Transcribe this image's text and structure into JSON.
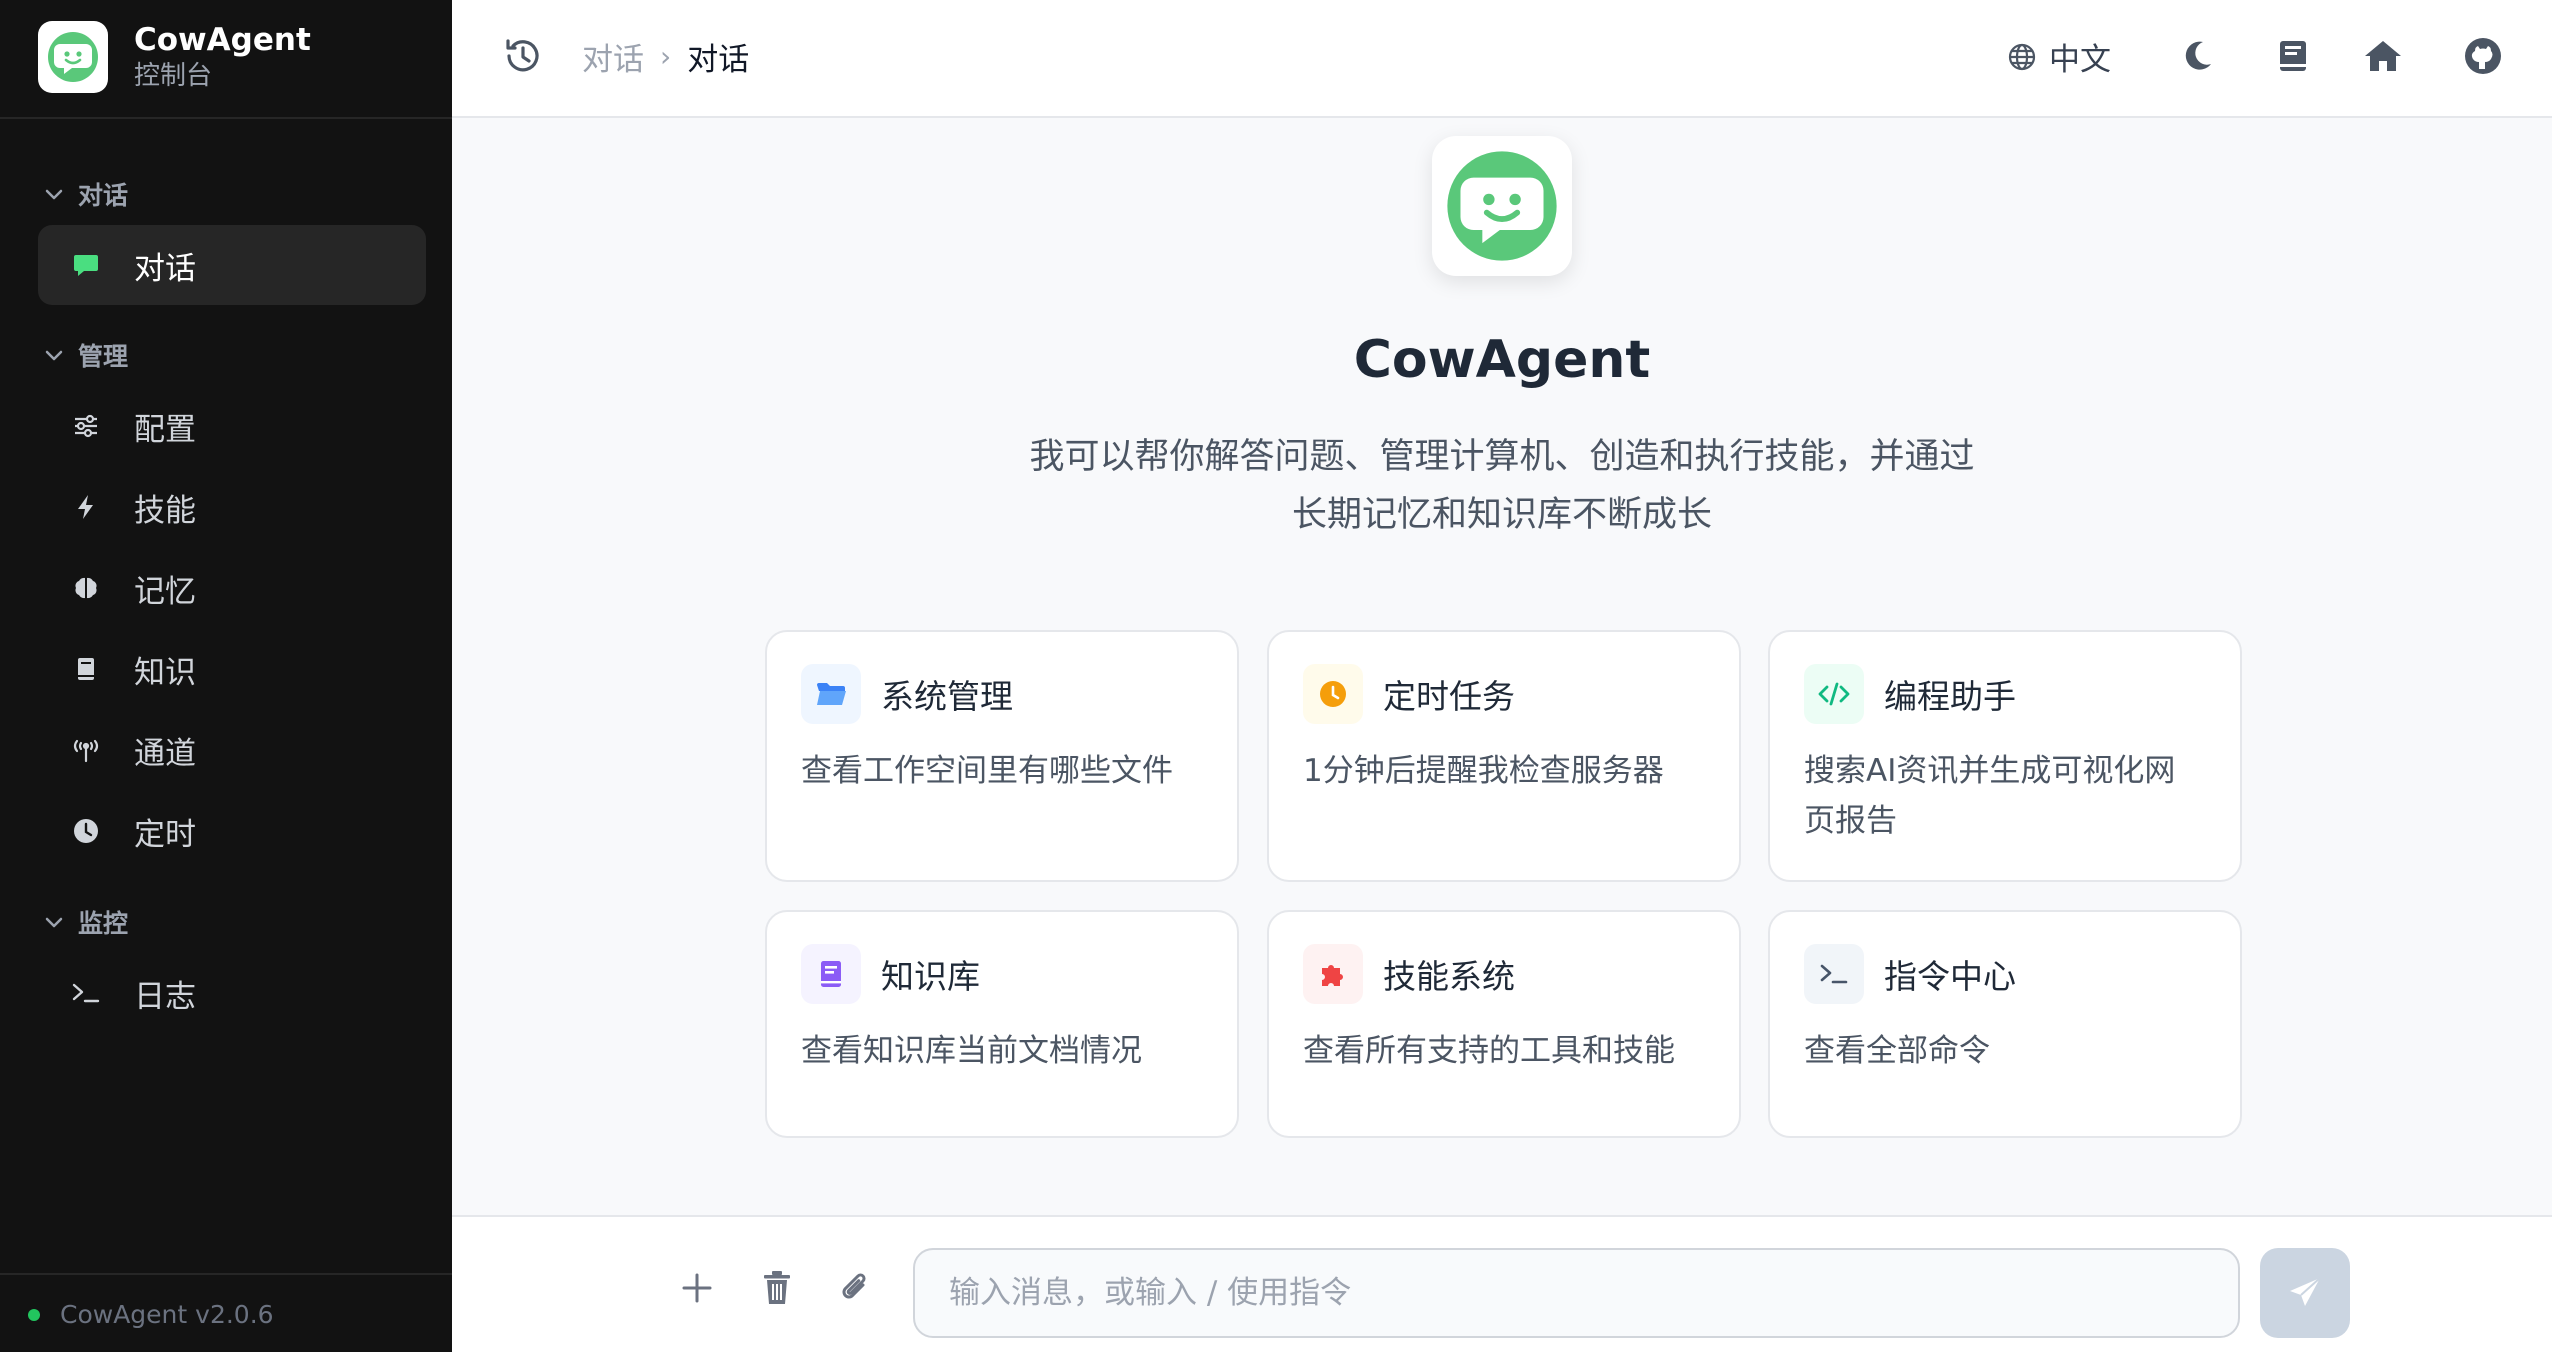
{
  "brand": {
    "name": "CowAgent",
    "subtitle": "控制台"
  },
  "sidebar": {
    "groups": [
      {
        "label": "对话",
        "items": [
          {
            "label": "对话",
            "icon": "chat-bubble-icon",
            "active": true
          }
        ]
      },
      {
        "label": "管理",
        "items": [
          {
            "label": "配置",
            "icon": "sliders-icon"
          },
          {
            "label": "技能",
            "icon": "bolt-icon"
          },
          {
            "label": "记忆",
            "icon": "brain-icon"
          },
          {
            "label": "知识",
            "icon": "book-icon"
          },
          {
            "label": "通道",
            "icon": "antenna-icon"
          },
          {
            "label": "定时",
            "icon": "clock-icon"
          }
        ]
      },
      {
        "label": "监控",
        "items": [
          {
            "label": "日志",
            "icon": "terminal-icon"
          }
        ]
      }
    ],
    "version": "CowAgent v2.0.6"
  },
  "header": {
    "breadcrumb": [
      "对话",
      "对话"
    ],
    "language": "中文"
  },
  "hero": {
    "title": "CowAgent",
    "description_line1": "我可以帮你解答问题、管理计算机、创造和执行技能，并通过",
    "description_line2": "长期记忆和知识库不断成长"
  },
  "cards": [
    {
      "title": "系统管理",
      "desc": "查看工作空间里有哪些文件",
      "icon": "folder-icon",
      "color": "#3b82f6"
    },
    {
      "title": "定时任务",
      "desc": "1分钟后提醒我检查服务器",
      "icon": "clock-icon",
      "color": "#f59e0b"
    },
    {
      "title": "编程助手",
      "desc": "搜索AI资讯并生成可视化网页报告",
      "icon": "code-icon",
      "color": "#10b981"
    },
    {
      "title": "知识库",
      "desc": "查看知识库当前文档情况",
      "icon": "book-icon",
      "color": "#8b5cf6"
    },
    {
      "title": "技能系统",
      "desc": "查看所有支持的工具和技能",
      "icon": "puzzle-icon",
      "color": "#ef4444"
    },
    {
      "title": "指令中心",
      "desc": "查看全部命令",
      "icon": "terminal-icon",
      "color": "#475569"
    }
  ],
  "input": {
    "placeholder": "输入消息，或输入 / 使用指令",
    "value": ""
  },
  "colors": {
    "brand_green": "#5ac87a",
    "sidebar_bg": "#121212",
    "status_dot": "#22c55e"
  }
}
